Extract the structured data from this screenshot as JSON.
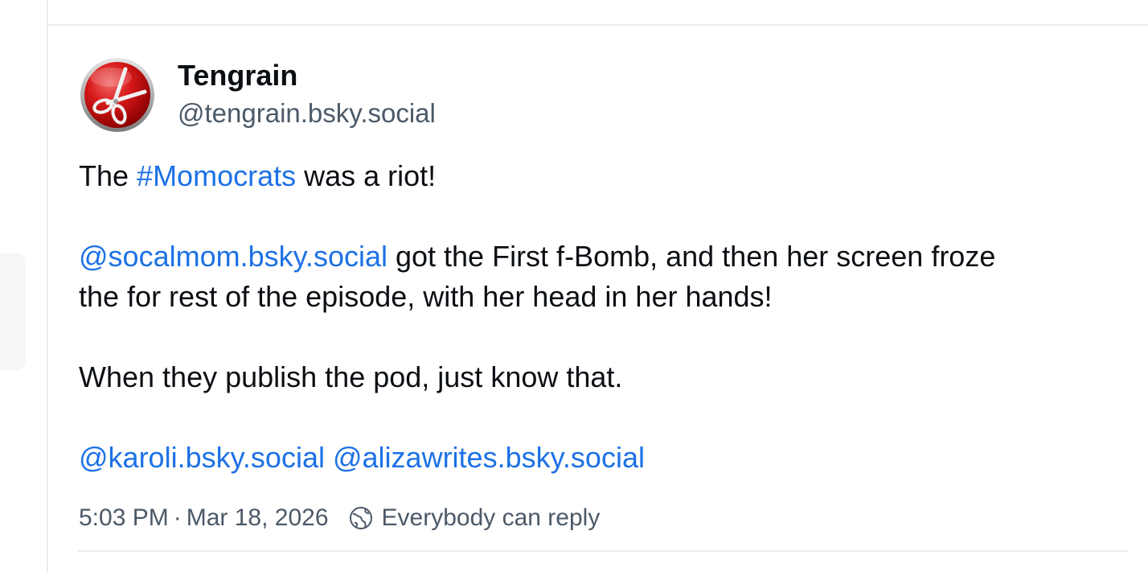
{
  "post": {
    "author": {
      "display_name": "Tengrain",
      "handle": "@tengrain.bsky.social",
      "avatar_icon": "red-scissors-avatar-icon"
    },
    "body": {
      "p1": {
        "text_before": "The ",
        "hashtag": "#Momocrats",
        "text_after": " was a riot!"
      },
      "p2": {
        "mention": "@socalmom.bsky.social",
        "line1_rest": " got the First f-Bomb, and then her screen froze",
        "line2": "the for rest of the episode, with her head in her hands!"
      },
      "p3": {
        "text": "When they publish the pod, just know that."
      },
      "p4": {
        "mention1": "@karoli.bsky.social",
        "mention2": "@alizawrites.bsky.social"
      }
    },
    "meta": {
      "time": "5:03 PM",
      "separator": "·",
      "date": "Mar 18, 2026",
      "reply_icon": "globe-icon",
      "reply_setting": "Everybody can reply"
    }
  },
  "colors": {
    "link": "#1c71e5",
    "secondary_text": "#4b5968",
    "divider": "#e8ebee"
  }
}
